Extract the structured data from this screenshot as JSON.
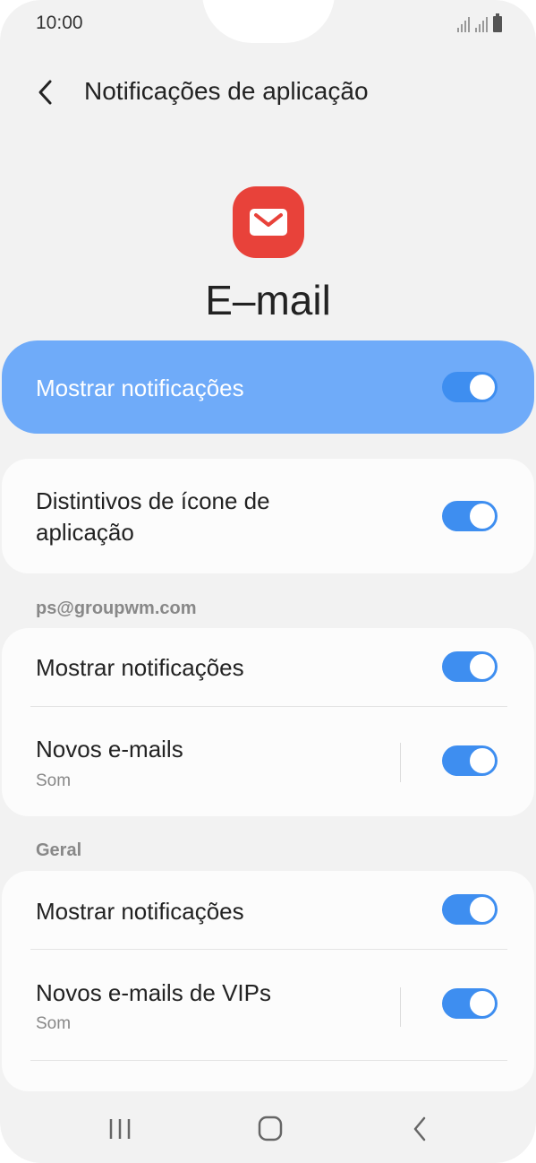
{
  "status_bar": {
    "time": "10:00"
  },
  "header": {
    "title": "Notificações de aplicação"
  },
  "app": {
    "name": "E–mail",
    "icon": "mail-icon",
    "icon_color": "#e8423a"
  },
  "hero": {
    "label": "Mostrar notificações",
    "enabled": true
  },
  "badges": {
    "label_line1": "Distintivos de ícone de",
    "label_line2": "aplicação",
    "enabled": true
  },
  "account": {
    "header": "ps@groupwm.com",
    "items": [
      {
        "title": "Mostrar notificações",
        "enabled": true
      },
      {
        "title": "Novos e-mails",
        "subtitle": "Som",
        "enabled": true
      }
    ]
  },
  "general": {
    "header": "Geral",
    "items": [
      {
        "title": "Mostrar notificações",
        "enabled": true
      },
      {
        "title": "Novos e-mails de VIPs",
        "subtitle": "Som",
        "enabled": true
      }
    ]
  },
  "colors": {
    "accent": "#3e8ef0",
    "hero_bg": "#6fabf9",
    "background": "#f2f2f2"
  },
  "nav": {
    "icons": [
      "recent-apps-icon",
      "home-icon",
      "back-icon"
    ]
  }
}
